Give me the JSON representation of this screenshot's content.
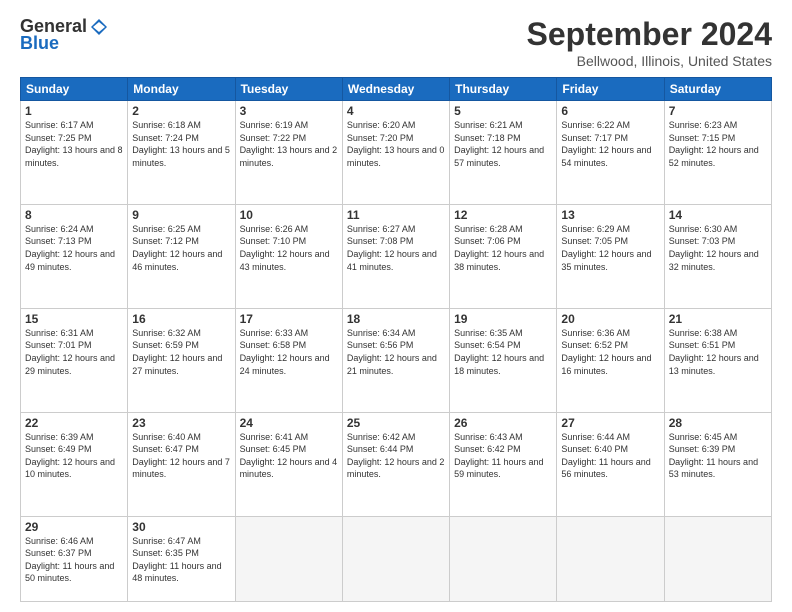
{
  "header": {
    "logo": {
      "general": "General",
      "blue": "Blue"
    },
    "title": "September 2024",
    "location": "Bellwood, Illinois, United States"
  },
  "calendar": {
    "days_of_week": [
      "Sunday",
      "Monday",
      "Tuesday",
      "Wednesday",
      "Thursday",
      "Friday",
      "Saturday"
    ],
    "weeks": [
      [
        {
          "day": "1",
          "sunrise": "6:17 AM",
          "sunset": "7:25 PM",
          "daylight": "13 hours and 8 minutes."
        },
        {
          "day": "2",
          "sunrise": "6:18 AM",
          "sunset": "7:24 PM",
          "daylight": "13 hours and 5 minutes."
        },
        {
          "day": "3",
          "sunrise": "6:19 AM",
          "sunset": "7:22 PM",
          "daylight": "13 hours and 2 minutes."
        },
        {
          "day": "4",
          "sunrise": "6:20 AM",
          "sunset": "7:20 PM",
          "daylight": "13 hours and 0 minutes."
        },
        {
          "day": "5",
          "sunrise": "6:21 AM",
          "sunset": "7:18 PM",
          "daylight": "12 hours and 57 minutes."
        },
        {
          "day": "6",
          "sunrise": "6:22 AM",
          "sunset": "7:17 PM",
          "daylight": "12 hours and 54 minutes."
        },
        {
          "day": "7",
          "sunrise": "6:23 AM",
          "sunset": "7:15 PM",
          "daylight": "12 hours and 52 minutes."
        }
      ],
      [
        {
          "day": "8",
          "sunrise": "6:24 AM",
          "sunset": "7:13 PM",
          "daylight": "12 hours and 49 minutes."
        },
        {
          "day": "9",
          "sunrise": "6:25 AM",
          "sunset": "7:12 PM",
          "daylight": "12 hours and 46 minutes."
        },
        {
          "day": "10",
          "sunrise": "6:26 AM",
          "sunset": "7:10 PM",
          "daylight": "12 hours and 43 minutes."
        },
        {
          "day": "11",
          "sunrise": "6:27 AM",
          "sunset": "7:08 PM",
          "daylight": "12 hours and 41 minutes."
        },
        {
          "day": "12",
          "sunrise": "6:28 AM",
          "sunset": "7:06 PM",
          "daylight": "12 hours and 38 minutes."
        },
        {
          "day": "13",
          "sunrise": "6:29 AM",
          "sunset": "7:05 PM",
          "daylight": "12 hours and 35 minutes."
        },
        {
          "day": "14",
          "sunrise": "6:30 AM",
          "sunset": "7:03 PM",
          "daylight": "12 hours and 32 minutes."
        }
      ],
      [
        {
          "day": "15",
          "sunrise": "6:31 AM",
          "sunset": "7:01 PM",
          "daylight": "12 hours and 29 minutes."
        },
        {
          "day": "16",
          "sunrise": "6:32 AM",
          "sunset": "6:59 PM",
          "daylight": "12 hours and 27 minutes."
        },
        {
          "day": "17",
          "sunrise": "6:33 AM",
          "sunset": "6:58 PM",
          "daylight": "12 hours and 24 minutes."
        },
        {
          "day": "18",
          "sunrise": "6:34 AM",
          "sunset": "6:56 PM",
          "daylight": "12 hours and 21 minutes."
        },
        {
          "day": "19",
          "sunrise": "6:35 AM",
          "sunset": "6:54 PM",
          "daylight": "12 hours and 18 minutes."
        },
        {
          "day": "20",
          "sunrise": "6:36 AM",
          "sunset": "6:52 PM",
          "daylight": "12 hours and 16 minutes."
        },
        {
          "day": "21",
          "sunrise": "6:38 AM",
          "sunset": "6:51 PM",
          "daylight": "12 hours and 13 minutes."
        }
      ],
      [
        {
          "day": "22",
          "sunrise": "6:39 AM",
          "sunset": "6:49 PM",
          "daylight": "12 hours and 10 minutes."
        },
        {
          "day": "23",
          "sunrise": "6:40 AM",
          "sunset": "6:47 PM",
          "daylight": "12 hours and 7 minutes."
        },
        {
          "day": "24",
          "sunrise": "6:41 AM",
          "sunset": "6:45 PM",
          "daylight": "12 hours and 4 minutes."
        },
        {
          "day": "25",
          "sunrise": "6:42 AM",
          "sunset": "6:44 PM",
          "daylight": "12 hours and 2 minutes."
        },
        {
          "day": "26",
          "sunrise": "6:43 AM",
          "sunset": "6:42 PM",
          "daylight": "11 hours and 59 minutes."
        },
        {
          "day": "27",
          "sunrise": "6:44 AM",
          "sunset": "6:40 PM",
          "daylight": "11 hours and 56 minutes."
        },
        {
          "day": "28",
          "sunrise": "6:45 AM",
          "sunset": "6:39 PM",
          "daylight": "11 hours and 53 minutes."
        }
      ],
      [
        {
          "day": "29",
          "sunrise": "6:46 AM",
          "sunset": "6:37 PM",
          "daylight": "11 hours and 50 minutes."
        },
        {
          "day": "30",
          "sunrise": "6:47 AM",
          "sunset": "6:35 PM",
          "daylight": "11 hours and 48 minutes."
        },
        null,
        null,
        null,
        null,
        null
      ]
    ]
  }
}
